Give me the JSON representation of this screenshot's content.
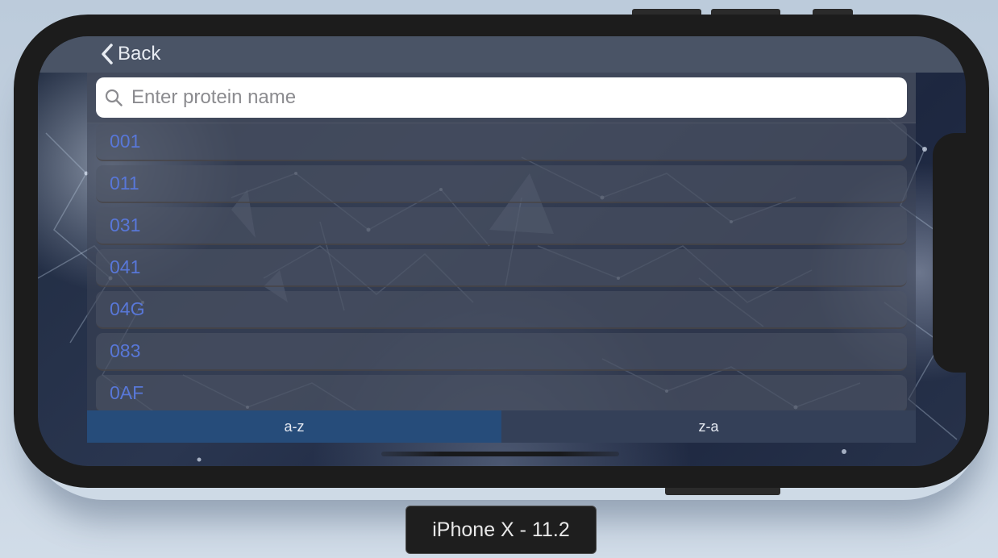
{
  "navbar": {
    "back_label": "Back"
  },
  "search": {
    "placeholder": "Enter protein name",
    "value": ""
  },
  "proteins": [
    "001",
    "011",
    "031",
    "041",
    "04G",
    "083",
    "0AF"
  ],
  "sort": {
    "az_label": "a-z",
    "za_label": "z-a",
    "selected": "a-z"
  },
  "device": {
    "label": "iPhone X - 11.2"
  },
  "colors": {
    "item_text": "#5877d8",
    "sort_active": "#264c7a",
    "sort_inactive": "#344058",
    "navbar": "#4a5466"
  },
  "icons": {
    "back": "chevron-left-icon",
    "search": "magnifier-icon"
  }
}
